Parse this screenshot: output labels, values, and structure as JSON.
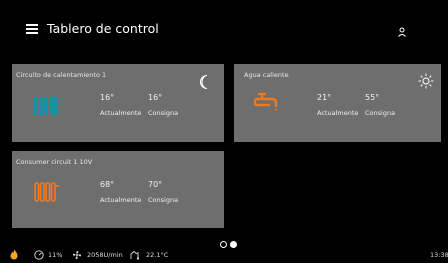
{
  "header": {
    "title": "Tablero de control",
    "menu_icon": "hamburger-menu-icon",
    "user_icon": "user-icon"
  },
  "tiles": [
    {
      "title": "Circuito de calentamiento 1",
      "icon": "radiator-icon",
      "icon_color": "#1a8fa0",
      "mode_icon": "moon-icon",
      "current_value": "16°",
      "setpoint_value": "16°",
      "current_label": "Actualmente",
      "setpoint_label": "Consigna"
    },
    {
      "title": "Agua caliente",
      "icon": "faucet-icon",
      "icon_color": "#f07a1e",
      "mode_icon": "sun-icon",
      "current_value": "21°",
      "setpoint_value": "55°",
      "current_label": "Actualmente",
      "setpoint_label": "Consigna"
    },
    {
      "title": "Consumer circuit 1 10V",
      "icon": "radiator-icon",
      "icon_color": "#f07a1e",
      "current_value": "68°",
      "setpoint_value": "70°",
      "current_label": "Actualmente",
      "setpoint_label": "Consigna"
    }
  ],
  "pager": {
    "page_count": 2,
    "active_page": 2
  },
  "statusbar": {
    "flame_icon": "flame-icon",
    "flame_color": "#f5a623",
    "gauge_icon": "gauge-icon",
    "modulation": "11%",
    "fan_icon": "fan-icon",
    "fan_speed": "2058U/min",
    "outdoor_icon": "outdoor-temperature-icon",
    "outdoor_temp": "22.1°C",
    "time": "13:38"
  },
  "colors": {
    "background": "#000000",
    "tile": "#6e6e6e",
    "accent_orange": "#f07a1e",
    "accent_teal": "#1a8fa0"
  }
}
